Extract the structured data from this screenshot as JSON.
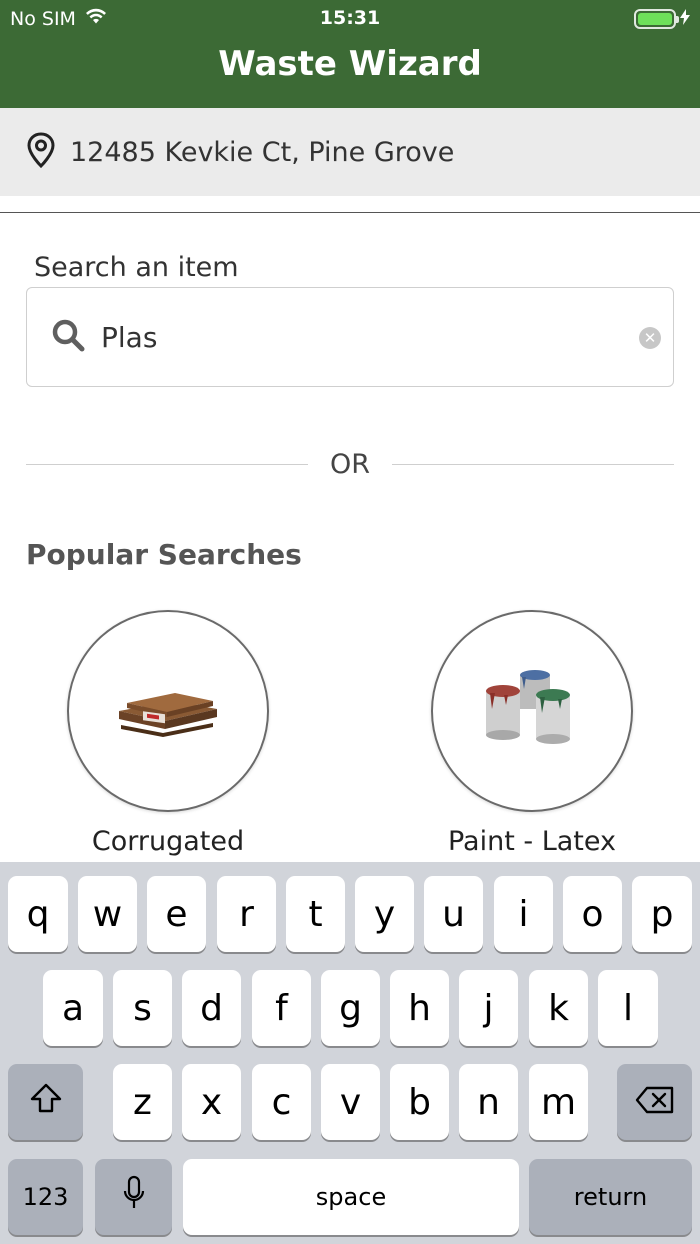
{
  "status_bar": {
    "carrier": "No SIM",
    "time": "15:31"
  },
  "header": {
    "title": "Waste Wizard"
  },
  "address": {
    "text": "12485 Kevkie Ct, Pine Grove"
  },
  "search": {
    "label": "Search an item",
    "value": "Plas"
  },
  "separator": {
    "text": "OR"
  },
  "popular": {
    "title": "Popular Searches",
    "items": [
      {
        "label": "Corrugated",
        "icon": "cardboard-stack-icon"
      },
      {
        "label": "Paint - Latex",
        "icon": "paint-cans-icon"
      }
    ]
  },
  "keyboard": {
    "row1": [
      "q",
      "w",
      "e",
      "r",
      "t",
      "y",
      "u",
      "i",
      "o",
      "p"
    ],
    "row2": [
      "a",
      "s",
      "d",
      "f",
      "g",
      "h",
      "j",
      "k",
      "l"
    ],
    "row3": [
      "z",
      "x",
      "c",
      "v",
      "b",
      "n",
      "m"
    ],
    "numbers_label": "123",
    "space_label": "space",
    "return_label": "return"
  },
  "colors": {
    "brand_green": "#3c6a35",
    "address_bg": "#ebebeb",
    "keyboard_bg": "#d1d4da",
    "battery_fill": "#6ee05a"
  }
}
